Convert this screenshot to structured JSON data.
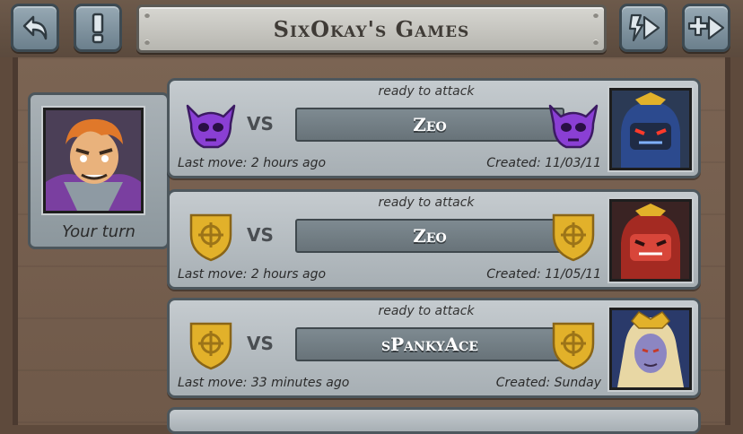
{
  "header": {
    "title": "SixOkay's Games",
    "buttons": [
      {
        "icon": "back-arrow-icon"
      },
      {
        "icon": "exclamation-icon"
      },
      {
        "icon": "quick-play-icon"
      },
      {
        "icon": "new-game-plus-icon"
      }
    ]
  },
  "player": {
    "status_label": "Your turn",
    "avatar": "orange-haired-warrior-portrait"
  },
  "games": [
    {
      "status": "ready to attack",
      "vs": "VS",
      "opponent": "Zeo",
      "last_move": "Last move: 2 hours ago",
      "created": "Created: 11/03/11",
      "emblem": "purple-skull-emblem",
      "opponent_avatar": "blue-samurai-portrait"
    },
    {
      "status": "ready to attack",
      "vs": "VS",
      "opponent": "Zeo",
      "last_move": "Last move: 2 hours ago",
      "created": "Created: 11/05/11",
      "emblem": "gold-shield-emblem",
      "opponent_avatar": "red-samurai-portrait"
    },
    {
      "status": "ready to attack",
      "vs": "VS",
      "opponent": "sPankyAce",
      "last_move": "Last move: 33 minutes ago",
      "created": "Created: Sunday",
      "emblem": "gold-shield-emblem",
      "opponent_avatar": "elf-queen-portrait"
    }
  ],
  "colors": {
    "purple_emblem": "#8a3fd4",
    "gold_emblem": "#e2b12a",
    "panel": "#b3bbc0",
    "wood": "#74604f"
  }
}
